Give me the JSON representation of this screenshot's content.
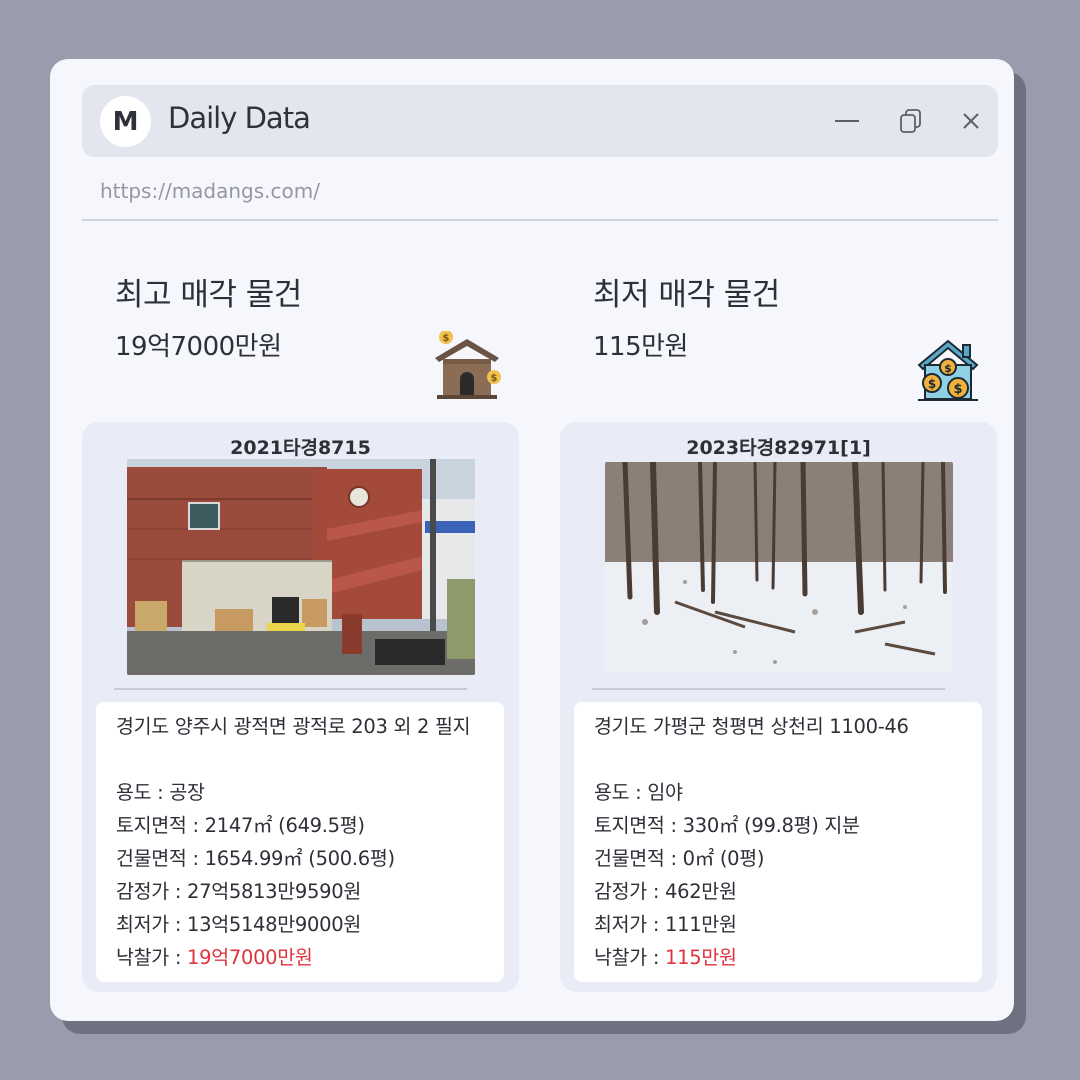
{
  "window": {
    "logo_letter": "M",
    "title": "Daily Data",
    "url": "https://madangs.com/"
  },
  "highest": {
    "heading": "최고 매각 물건",
    "price": "19억7000만원",
    "icon": "house-with-coins-icon",
    "case_no": "2021타경8715",
    "photo": "factory-building-photo",
    "address": "경기도 양주시 광적면 광적로 203 외 2 필지",
    "usage": "용도 : 공장",
    "land_area": "토지면적 : 2147㎡ (649.5평)",
    "building_area": "건물면적 : 1654.99㎡ (500.6평)",
    "appraisal": "감정가 : 27억5813만9590원",
    "minimum": "최저가 : 13억5148만9000원",
    "winning_label": "낙찰가 : ",
    "winning_value": "19억7000만원"
  },
  "lowest": {
    "heading": "최저 매각 물건",
    "price": "115만원",
    "icon": "house-with-money-icon",
    "case_no": "2023타경82971[1]",
    "photo": "snowy-forest-photo",
    "address": "경기도 가평군 청평면 상천리 1100-46",
    "usage": "용도 :  임야",
    "land_area": "토지면적 : 330㎡ (99.8평) 지분",
    "building_area": "건물면적 : 0㎡ (0평)",
    "appraisal": "감정가 : 462만원",
    "minimum": "최저가 : 111만원",
    "winning_label": "낙찰가 : ",
    "winning_value": "115만원"
  },
  "colors": {
    "background": "#9a9cad",
    "window": "#f6f7fc",
    "titlebar": "#e4e6ef",
    "card": "#e9ebf6",
    "accent_red": "#e0333d"
  }
}
